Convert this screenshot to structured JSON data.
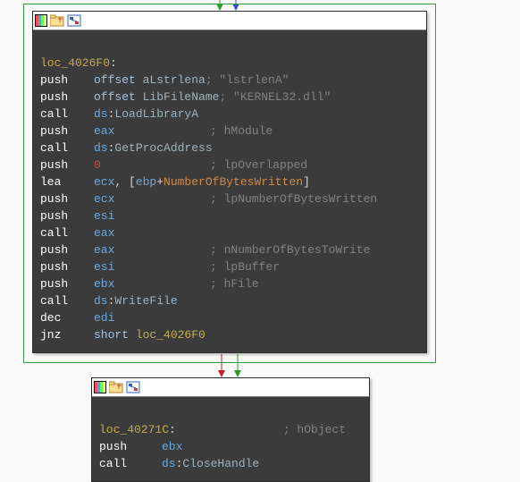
{
  "node1": {
    "label": "loc_4026F0",
    "lines": [
      {
        "mnem": "push",
        "opw": 60,
        "ops": [
          {
            "t": "offset ",
            "c": "kw"
          },
          {
            "t": "aLstrlena",
            "c": "api"
          }
        ],
        "comment": "; \"lstrlenA\""
      },
      {
        "mnem": "push",
        "opw": 60,
        "ops": [
          {
            "t": "offset ",
            "c": "kw"
          },
          {
            "t": "LibFileName",
            "c": "api"
          }
        ],
        "comment": "; \"KERNEL32.dll\""
      },
      {
        "mnem": "call",
        "opw": 60,
        "ops": [
          {
            "t": "ds",
            "c": "reg"
          },
          {
            "t": ":",
            "c": "punct"
          },
          {
            "t": "LoadLibraryA",
            "c": "api"
          }
        ]
      },
      {
        "mnem": "push",
        "opw": 60,
        "ops": [
          {
            "t": "eax",
            "c": "reg"
          }
        ],
        "opspad": 130,
        "comment": "; hModule"
      },
      {
        "mnem": "call",
        "opw": 60,
        "ops": [
          {
            "t": "ds",
            "c": "reg"
          },
          {
            "t": ":",
            "c": "punct"
          },
          {
            "t": "GetProcAddress",
            "c": "api"
          }
        ]
      },
      {
        "mnem": "push",
        "opw": 60,
        "ops": [
          {
            "t": "0",
            "c": "num"
          }
        ],
        "opspad": 130,
        "comment": "; lpOverlapped"
      },
      {
        "mnem": "lea",
        "opw": 60,
        "ops": [
          {
            "t": "ecx",
            "c": "reg"
          },
          {
            "t": ", [",
            "c": "punct"
          },
          {
            "t": "ebp",
            "c": "reg"
          },
          {
            "t": "+",
            "c": "punct"
          },
          {
            "t": "NumberOfBytesWritten",
            "c": "var"
          },
          {
            "t": "]",
            "c": "punct"
          }
        ]
      },
      {
        "mnem": "push",
        "opw": 60,
        "ops": [
          {
            "t": "ecx",
            "c": "reg"
          }
        ],
        "opspad": 130,
        "comment": "; lpNumberOfBytesWritten"
      },
      {
        "mnem": "push",
        "opw": 60,
        "ops": [
          {
            "t": "esi",
            "c": "reg"
          }
        ]
      },
      {
        "mnem": "call",
        "opw": 60,
        "ops": [
          {
            "t": "eax",
            "c": "reg"
          }
        ]
      },
      {
        "mnem": "push",
        "opw": 60,
        "ops": [
          {
            "t": "eax",
            "c": "reg"
          }
        ],
        "opspad": 130,
        "comment": "; nNumberOfBytesToWrite"
      },
      {
        "mnem": "push",
        "opw": 60,
        "ops": [
          {
            "t": "esi",
            "c": "reg"
          }
        ],
        "opspad": 130,
        "comment": "; lpBuffer"
      },
      {
        "mnem": "push",
        "opw": 60,
        "ops": [
          {
            "t": "ebx",
            "c": "reg"
          }
        ],
        "opspad": 130,
        "comment": "; hFile"
      },
      {
        "mnem": "call",
        "opw": 60,
        "ops": [
          {
            "t": "ds",
            "c": "reg"
          },
          {
            "t": ":",
            "c": "punct"
          },
          {
            "t": "WriteFile",
            "c": "api"
          }
        ]
      },
      {
        "mnem": "dec",
        "opw": 60,
        "ops": [
          {
            "t": "edi",
            "c": "reg"
          }
        ]
      },
      {
        "mnem": "jnz",
        "opw": 60,
        "ops": [
          {
            "t": "short ",
            "c": "kw"
          },
          {
            "t": "loc_4026F0",
            "c": "loc-label"
          }
        ]
      }
    ]
  },
  "node2": {
    "label": "loc_40271C",
    "lines": [
      {
        "label_comment": "; hObject"
      },
      {
        "mnem": "push",
        "opw": 70,
        "ops": [
          {
            "t": "ebx",
            "c": "reg"
          }
        ]
      },
      {
        "mnem": "call",
        "opw": 70,
        "ops": [
          {
            "t": "ds",
            "c": "reg"
          },
          {
            "t": ":",
            "c": "punct"
          },
          {
            "t": "CloseHandle",
            "c": "api"
          }
        ]
      }
    ]
  },
  "icons": {
    "palette": "palette-icon",
    "folder": "folder-icon",
    "graph": "graph-icon"
  }
}
